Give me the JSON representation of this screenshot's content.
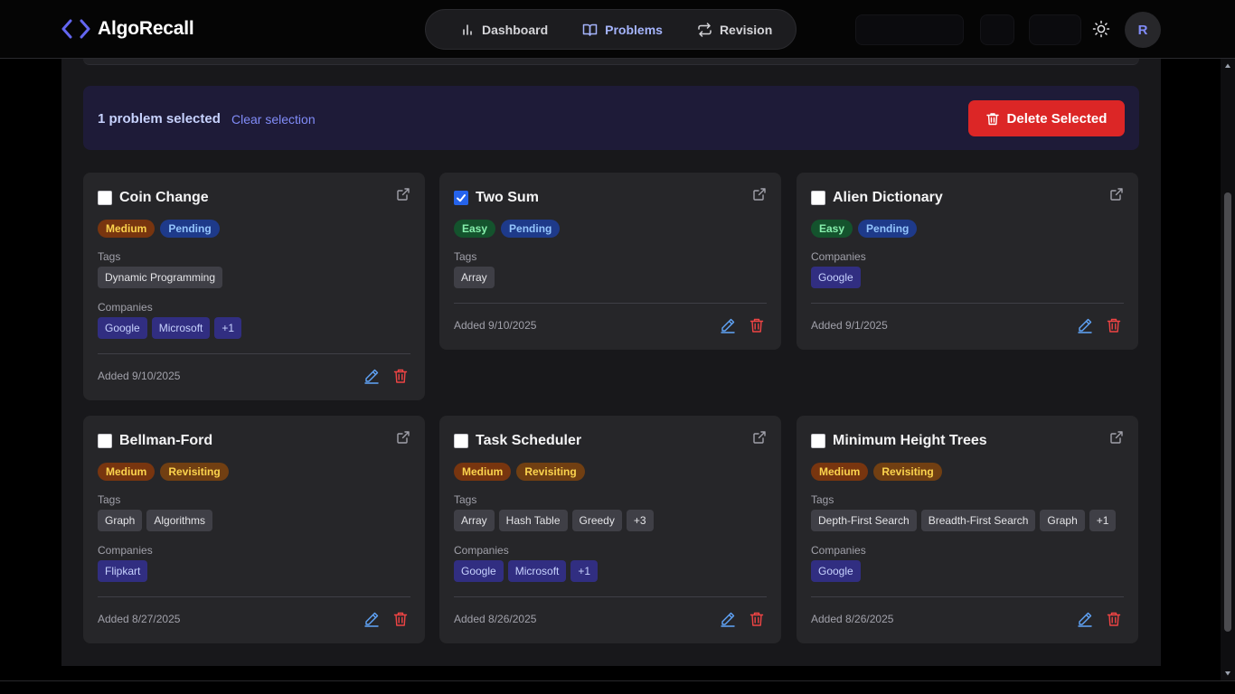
{
  "app": {
    "name": "AlgoRecall"
  },
  "nav": {
    "dashboard": "Dashboard",
    "problems": "Problems",
    "revision": "Revision"
  },
  "user": {
    "initial": "R"
  },
  "selection": {
    "count_text": "1 problem selected",
    "clear_label": "Clear selection",
    "delete_label": "Delete Selected"
  },
  "labels": {
    "tags": "Tags",
    "companies": "Companies"
  },
  "problems": [
    {
      "title": "Coin Change",
      "checked": false,
      "difficulty": "Medium",
      "status": "Pending",
      "tags": [
        "Dynamic Programming"
      ],
      "companies": [
        "Google",
        "Microsoft",
        "+1"
      ],
      "added": "Added 9/10/2025"
    },
    {
      "title": "Two Sum",
      "checked": true,
      "difficulty": "Easy",
      "status": "Pending",
      "tags": [
        "Array"
      ],
      "companies": [],
      "added": "Added 9/10/2025"
    },
    {
      "title": "Alien Dictionary",
      "checked": false,
      "difficulty": "Easy",
      "status": "Pending",
      "tags": [],
      "companies": [
        "Google"
      ],
      "added": "Added 9/1/2025"
    },
    {
      "title": "Bellman-Ford",
      "checked": false,
      "difficulty": "Medium",
      "status": "Revisiting",
      "tags": [
        "Graph",
        "Algorithms"
      ],
      "companies": [
        "Flipkart"
      ],
      "added": "Added 8/27/2025"
    },
    {
      "title": "Task Scheduler",
      "checked": false,
      "difficulty": "Medium",
      "status": "Revisiting",
      "tags": [
        "Array",
        "Hash Table",
        "Greedy",
        "+3"
      ],
      "companies": [
        "Google",
        "Microsoft",
        "+1"
      ],
      "added": "Added 8/26/2025"
    },
    {
      "title": "Minimum Height Trees",
      "checked": false,
      "difficulty": "Medium",
      "status": "Revisiting",
      "tags": [
        "Depth-First Search",
        "Breadth-First Search",
        "Graph",
        "+1"
      ],
      "companies": [
        "Google"
      ],
      "added": "Added 8/26/2025"
    }
  ],
  "colors": {
    "accent": "#818cf8",
    "danger": "#dc2626",
    "edit": "#60a5fa",
    "delete_icon": "#ef4444"
  }
}
